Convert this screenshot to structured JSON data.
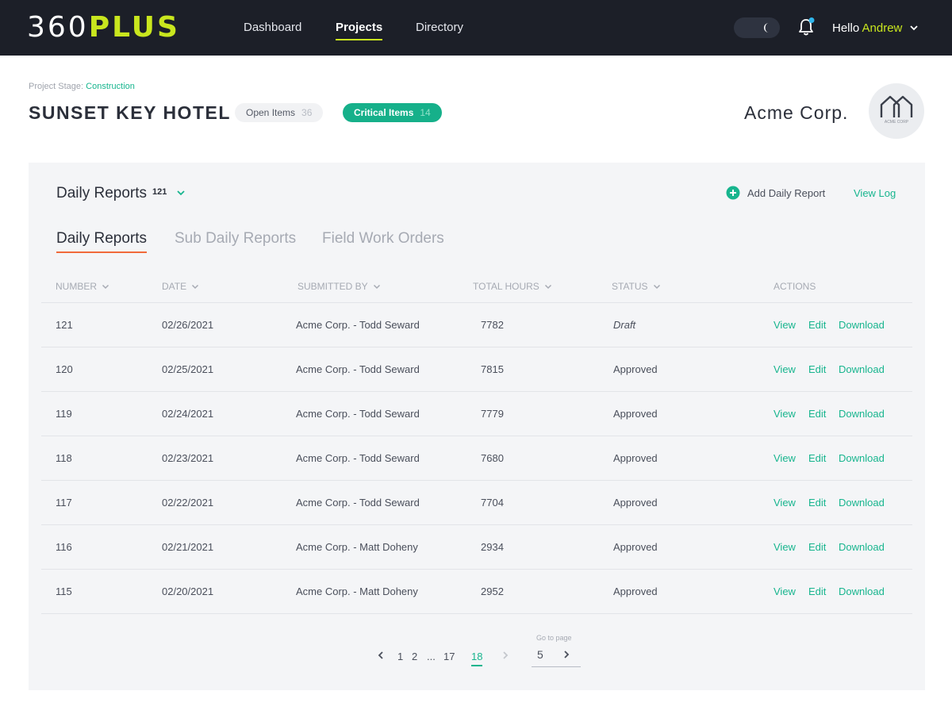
{
  "nav": {
    "logo_part1": "360",
    "logo_part2": "PLUS",
    "links": [
      "Dashboard",
      "Projects",
      "Directory"
    ],
    "greeting": "Hello",
    "user_name": "Andrew",
    "toggle_icon": "moon-icon",
    "bell_icon": "bell-icon"
  },
  "project": {
    "stage_label": "Project Stage:",
    "stage_value": "Construction",
    "title": "SUNSET KEY HOTEL",
    "open_items_label": "Open Items",
    "open_items_count": "36",
    "critical_items_label": "Critical Items",
    "critical_items_count": "14",
    "company": "Acme Corp.",
    "avatar_caption": "ACME CORP"
  },
  "section": {
    "title": "Daily Reports",
    "count": "121",
    "add_label": "Add Daily Report",
    "view_log": "View Log"
  },
  "tabs": [
    "Daily Reports",
    "Sub Daily Reports",
    "Field Work Orders"
  ],
  "table": {
    "headers": [
      "NUMBER",
      "DATE",
      "SUBMITTED BY",
      "TOTAL HOURS",
      "STATUS",
      "ACTIONS"
    ],
    "rows": [
      {
        "number": "121",
        "date": "02/26/2021",
        "submitted_by": "Acme Corp. - Todd Seward",
        "hours": "7782",
        "status": "Draft"
      },
      {
        "number": "120",
        "date": "02/25/2021",
        "submitted_by": "Acme Corp. - Todd Seward",
        "hours": "7815",
        "status": "Approved"
      },
      {
        "number": "119",
        "date": "02/24/2021",
        "submitted_by": "Acme Corp. - Todd Seward",
        "hours": "7779",
        "status": "Approved"
      },
      {
        "number": "118",
        "date": "02/23/2021",
        "submitted_by": "Acme Corp. - Todd Seward",
        "hours": "7680",
        "status": "Approved"
      },
      {
        "number": "117",
        "date": "02/22/2021",
        "submitted_by": "Acme Corp. - Todd Seward",
        "hours": "7704",
        "status": "Approved"
      },
      {
        "number": "116",
        "date": "02/21/2021",
        "submitted_by": "Acme Corp. - Matt Doheny",
        "hours": "2934",
        "status": "Approved"
      },
      {
        "number": "115",
        "date": "02/20/2021",
        "submitted_by": "Acme Corp. - Matt Doheny",
        "hours": "2952",
        "status": "Approved"
      }
    ],
    "actions": [
      "View",
      "Edit",
      "Download"
    ]
  },
  "pagination": {
    "pages": [
      "1",
      "2",
      "...",
      "17",
      "18"
    ],
    "current": "18",
    "goto_label": "Go to page",
    "goto_value": "5"
  },
  "colors": {
    "accent_green": "#17b58e",
    "logo_lime": "#c9e61e",
    "tab_underline": "#f06a3a",
    "nav_bg": "#1c1f28"
  }
}
